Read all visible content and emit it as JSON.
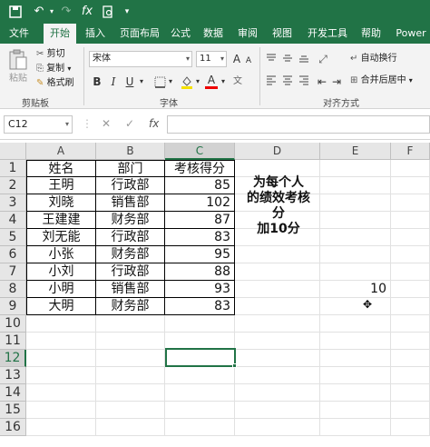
{
  "qat": {
    "save_icon": "save-icon",
    "undo_icon": "undo-icon",
    "redo_icon": "redo-icon",
    "fx": "fx",
    "preview_icon": "print-preview-icon"
  },
  "tabs": [
    "文件",
    "开始",
    "插入",
    "页面布局",
    "公式",
    "数据",
    "审阅",
    "视图",
    "开发工具",
    "帮助",
    "Power P"
  ],
  "ribbon": {
    "paste": "粘贴",
    "cut": "剪切",
    "copy": "复制",
    "format_painter": "格式刷",
    "clipboard": "剪贴板",
    "font_name": "宋体",
    "font_size": "11",
    "bold": "B",
    "italic": "I",
    "underline": "U",
    "font": "字体",
    "font_color_letter": "A",
    "highlight_letter": "A",
    "wrap_text": "自动换行",
    "merge_center": "合并后居中",
    "alignment": "对齐方式",
    "grow_font": "A",
    "shrink_font": "A"
  },
  "formula_bar": {
    "name_box": "C12",
    "fx": "fx",
    "value": ""
  },
  "columns": [
    "A",
    "B",
    "C",
    "D",
    "E",
    "F"
  ],
  "rows": [
    "1",
    "2",
    "3",
    "4",
    "5",
    "6",
    "7",
    "8",
    "9",
    "10",
    "11",
    "12",
    "13",
    "14",
    "15",
    "16"
  ],
  "table": {
    "header": [
      "姓名",
      "部门",
      "考核得分"
    ],
    "rows": [
      [
        "王明",
        "行政部",
        "85"
      ],
      [
        "刘晓",
        "销售部",
        "102"
      ],
      [
        "王建建",
        "财务部",
        "87"
      ],
      [
        "刘无能",
        "行政部",
        "83"
      ],
      [
        "小张",
        "财务部",
        "95"
      ],
      [
        "小刘",
        "行政部",
        "88"
      ],
      [
        "小明",
        "销售部",
        "93"
      ],
      [
        "大明",
        "财务部",
        "83"
      ]
    ]
  },
  "note_lines": [
    "为每个人",
    "的绩效考核",
    "分",
    "加10分"
  ],
  "e8_value": "10",
  "colors": {
    "accent": "#217346",
    "ribbon_bg": "#f3f3f3"
  }
}
